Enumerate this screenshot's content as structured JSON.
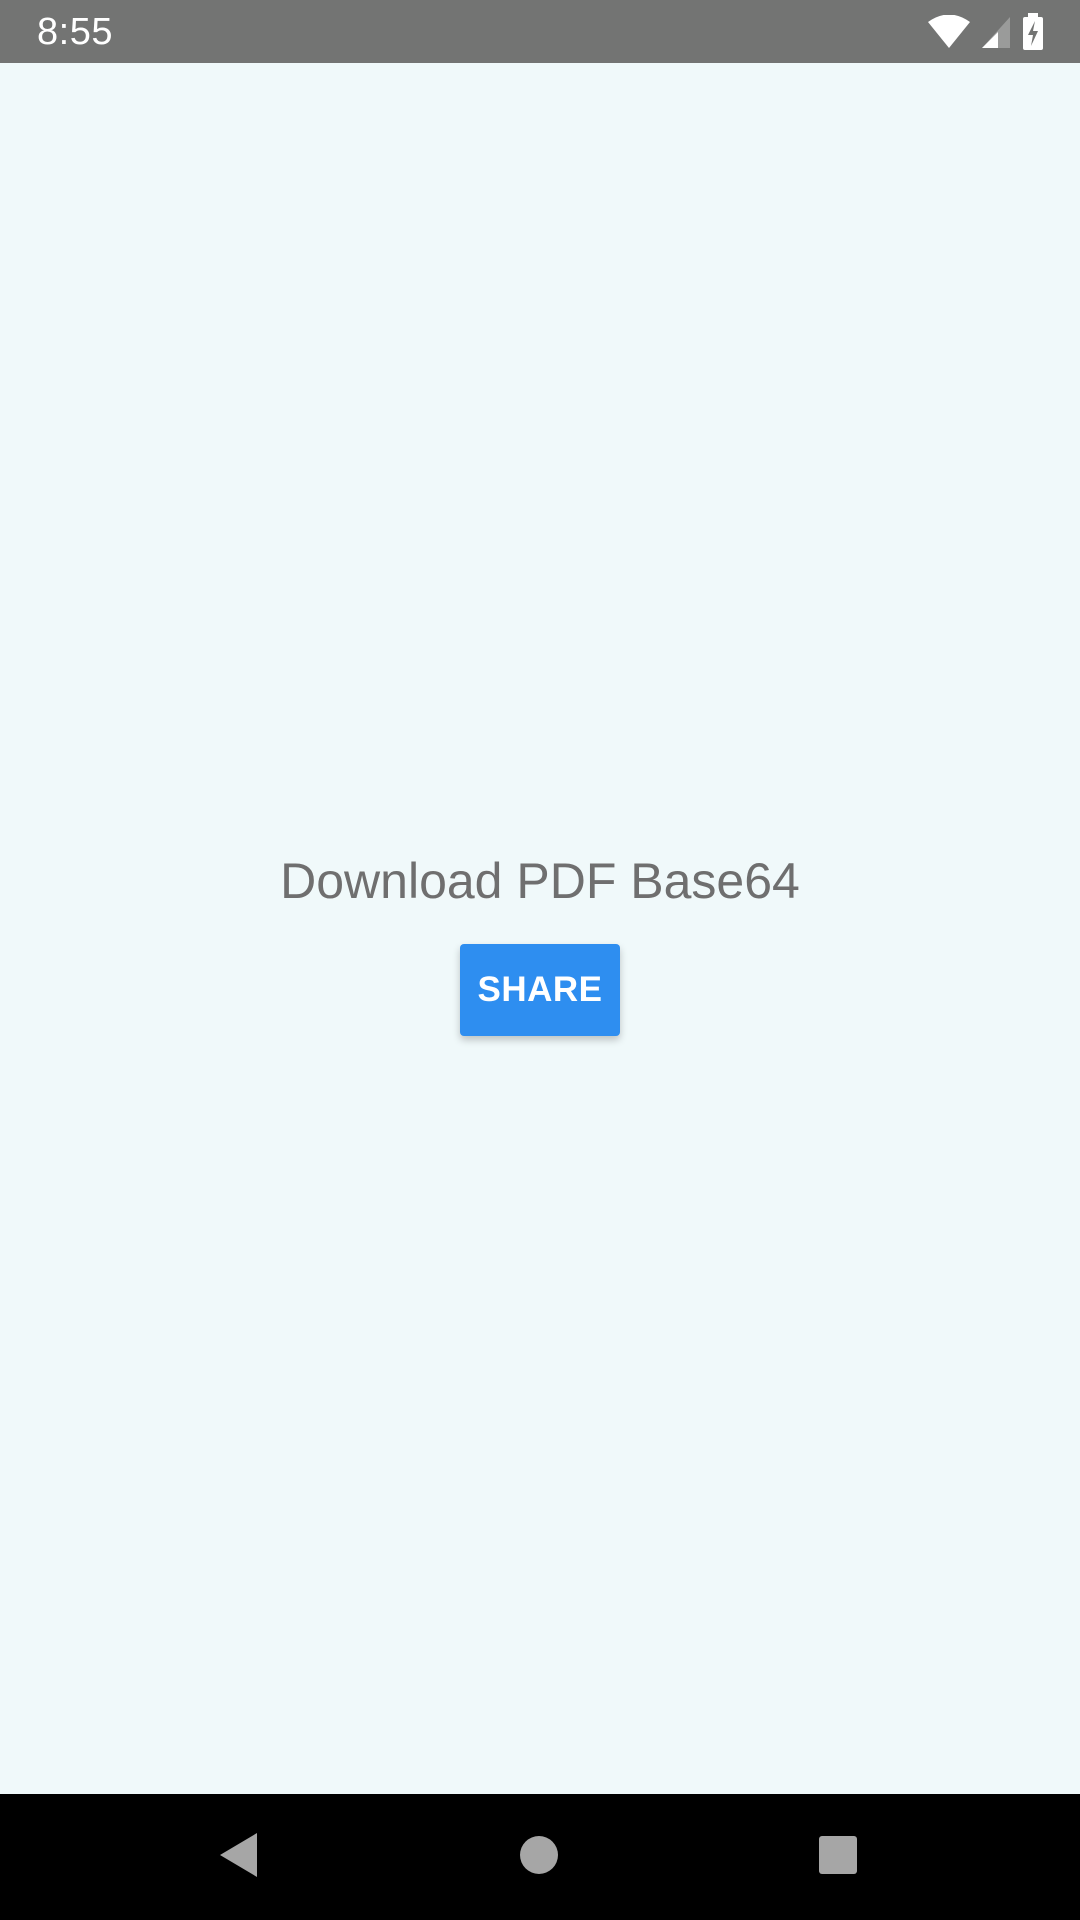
{
  "status_bar": {
    "time": "8:55",
    "icons": [
      "wifi-icon",
      "cell-signal-icon",
      "battery-charging-icon"
    ],
    "background": "#737473"
  },
  "main": {
    "heading": "Download PDF Base64",
    "share_button_label": "SHARE",
    "accent_color": "#2e8ef0",
    "background": "#f0f9fa"
  },
  "nav_bar": {
    "buttons": [
      "back-icon",
      "home-icon",
      "recents-icon"
    ]
  }
}
